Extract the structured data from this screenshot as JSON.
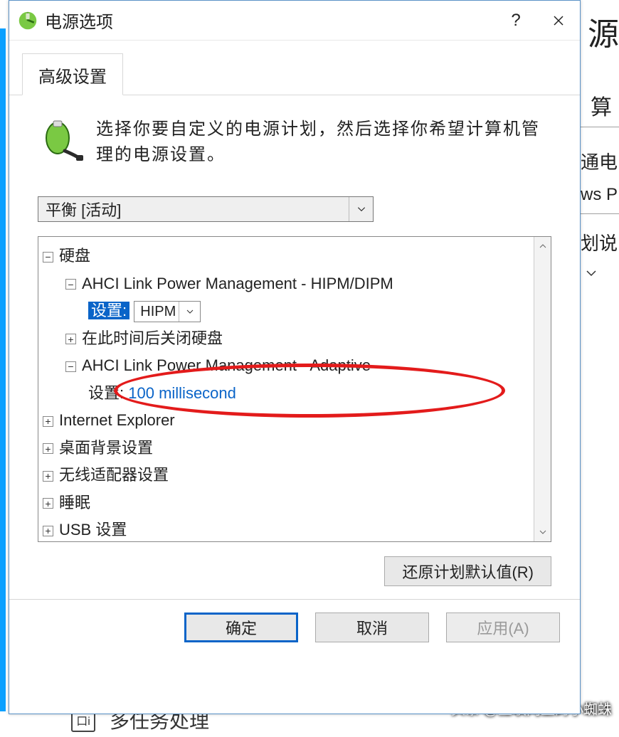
{
  "background": {
    "title_fragment": "源",
    "line1_fragment": "算",
    "line2_fragment": "通电",
    "line3_fragment": "ws P",
    "line4_fragment": "计划说",
    "bottom_icon_glyph": "口i",
    "bottom_text": "多任务处理",
    "watermark": "头条 @互联网上的小蜘蛛"
  },
  "dialog": {
    "title": "电源选项",
    "tab_label": "高级设置",
    "intro_text": "选择你要自定义的电源计划，然后选择你希望计算机管理的电源设置。",
    "plan_selected": "平衡 [活动]",
    "tree": {
      "hard_disk": "硬盘",
      "ahci_hipm": "AHCI Link Power Management - HIPM/DIPM",
      "setting_label": "设置:",
      "hipm_value": "HIPM",
      "close_after": "在此时间后关闭硬盘",
      "ahci_adaptive": "AHCI Link Power Management - Adaptive",
      "adaptive_value": "100 millisecond",
      "ie": "Internet Explorer",
      "desktop_bg": "桌面背景设置",
      "wireless": "无线适配器设置",
      "sleep": "睡眠",
      "usb": "USB 设置"
    },
    "restore_defaults": "还原计划默认值(R)",
    "ok": "确定",
    "cancel": "取消",
    "apply": "应用(A)"
  }
}
